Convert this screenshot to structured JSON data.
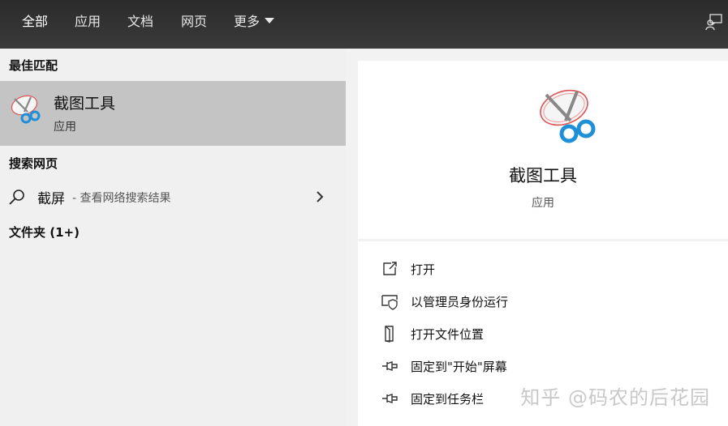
{
  "tabs": [
    {
      "label": "全部",
      "active": true
    },
    {
      "label": "应用"
    },
    {
      "label": "文档"
    },
    {
      "label": "网页"
    },
    {
      "label": "更多"
    }
  ],
  "sections": {
    "best_match": "最佳匹配",
    "search_web": "搜索网页",
    "folders": "文件夹 (1+)"
  },
  "best_match": {
    "name": "截图工具",
    "type": "应用"
  },
  "web_result": {
    "query": "截屏",
    "hint": "- 查看网络搜索结果"
  },
  "detail": {
    "title": "截图工具",
    "type": "应用"
  },
  "actions": [
    {
      "label": "打开",
      "icon": "open-icon"
    },
    {
      "label": "以管理员身份运行",
      "icon": "shield-icon"
    },
    {
      "label": "打开文件位置",
      "icon": "file-location-icon"
    },
    {
      "label": "固定到\"开始\"屏幕",
      "icon": "pin-icon"
    },
    {
      "label": "固定到任务栏",
      "icon": "pin-icon"
    }
  ],
  "watermark": "知乎 @码农的后花园"
}
